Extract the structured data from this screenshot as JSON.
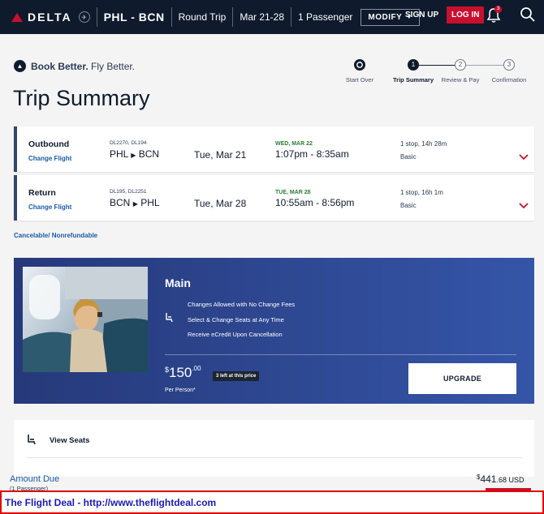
{
  "header": {
    "brand": "DELTA",
    "route": "PHL - BCN",
    "trip_type": "Round Trip",
    "dates": "Mar 21-28",
    "passengers": "1 Passenger",
    "modify_label": "MODIFY",
    "signup_label": "SIGN UP",
    "login_label": "LOG IN",
    "notification_count": "3"
  },
  "tagline": {
    "bold": "Book Better.",
    "rest": " Fly Better."
  },
  "title": "Trip Summary",
  "steps": [
    {
      "num": "",
      "label": "Start Over",
      "state": "icon"
    },
    {
      "num": "1",
      "label": "Trip Summary",
      "state": "active"
    },
    {
      "num": "2",
      "label": "Review & Pay",
      "state": "pending"
    },
    {
      "num": "3",
      "label": "Confirmation",
      "state": "pending"
    }
  ],
  "flights": [
    {
      "label": "Outbound",
      "change_label": "Change Flight",
      "flight_numbers": "DL2270, DL194",
      "from": "PHL",
      "to": "BCN",
      "date": "Tue, Mar 21",
      "arrival_date": "WED, MAR 22",
      "times": "1:07pm - 8:35am",
      "stops": "1 stop, 14h 28m",
      "cabin": "Basic"
    },
    {
      "label": "Return",
      "change_label": "Change Flight",
      "flight_numbers": "DL195, DL2251",
      "from": "BCN",
      "to": "PHL",
      "date": "Tue, Mar 28",
      "arrival_date": "TUE, MAR 28",
      "times": "10:55am - 8:56pm",
      "stops": "1 stop, 16h 1m",
      "cabin": "Basic"
    }
  ],
  "cancel_policy": "Cancelable/ Nonrefundable",
  "fare": {
    "name": "Main",
    "features": [
      "Changes Allowed with No Change Fees",
      "Select & Change Seats at Any Time",
      "Receive eCredit Upon Cancellation"
    ],
    "currency_symbol": "$",
    "price_whole": "150",
    "price_cents": ".00",
    "seats_left": "3 left at this price",
    "per_person": "Per Person*",
    "upgrade_label": "UPGRADE"
  },
  "view_seats_label": "View Seats",
  "amount_due": {
    "label": "Amount Due",
    "sub": "(1 Passenger)",
    "currency_symbol": "$",
    "whole": "441",
    "cents": ".68 USD"
  },
  "banner": "The Flight Deal - http://www.theflightdeal.com",
  "colors": {
    "navy": "#0f1a2c",
    "delta_red": "#c8102e",
    "link_blue": "#1a5aa8",
    "arrival_green": "#2e7d32",
    "fare_panel": "#3555a8"
  }
}
